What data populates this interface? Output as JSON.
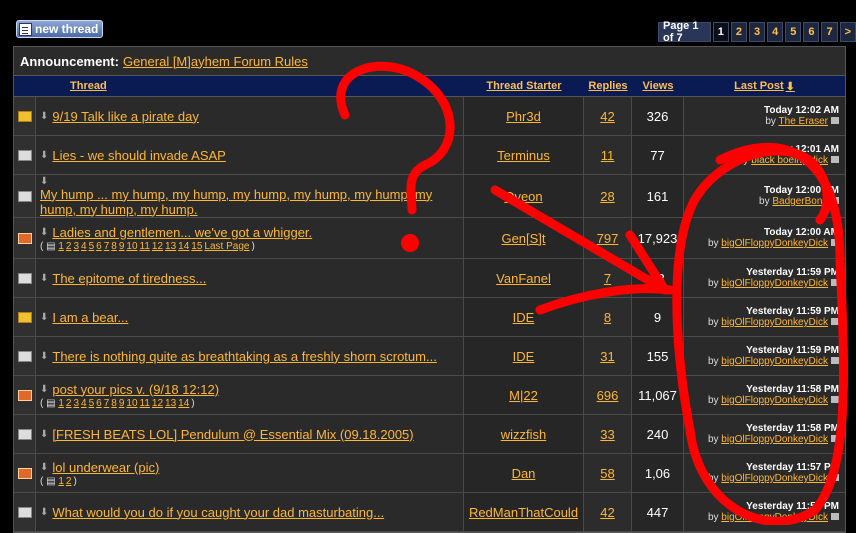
{
  "toolbar": {
    "new_thread_label": "new thread"
  },
  "pager": {
    "label": "Page 1 of 7",
    "current": "1",
    "pages": [
      "2",
      "3",
      "4",
      "5",
      "6",
      "7"
    ],
    "next": ">"
  },
  "announcement": {
    "prefix": "Announcement:",
    "title": "General [M]ayhem Forum Rules"
  },
  "columns": {
    "thread": "Thread",
    "starter": "Thread Starter",
    "replies": "Replies",
    "views": "Views",
    "last_post": "Last Post"
  },
  "threads": [
    {
      "icon": "poll",
      "title": "9/19 Talk like a pirate day",
      "starter": "Phr3d",
      "replies": "42",
      "views": "326",
      "lp_date": "Today 12:02 AM",
      "lp_user": "The Eraser",
      "h": 38
    },
    {
      "icon": "normal",
      "title": "Lies - we should invade ASAP",
      "starter": "Terminus",
      "replies": "11",
      "views": "77",
      "lp_date": "Today 12:01 AM",
      "lp_user": "black boeing dick",
      "h": 38
    },
    {
      "icon": "normal",
      "title": "My hump ... my hump, my hump, my hump, my hump, my hump, my hump, my hump, my hump.",
      "starter": "Qveon",
      "replies": "28",
      "views": "161",
      "lp_date": "Today 12:00 AM",
      "lp_user": "BadgerBong",
      "h": 42
    },
    {
      "icon": "hot",
      "title": "Ladies and gentlemen... we've got a whigger.",
      "pages": [
        "1",
        "2",
        "3",
        "4",
        "5",
        "6",
        "7",
        "8",
        "9",
        "10",
        "11",
        "12",
        "13",
        "14",
        "15"
      ],
      "last_page": "Last Page",
      "starter": "Gen[S]t",
      "replies": "797",
      "views": "17,923",
      "lp_date": "Today 12:00 AM",
      "lp_user": "bigOlFloppyDonkeyDick",
      "h": 40
    },
    {
      "icon": "normal",
      "title": "The epitome of tiredness...",
      "starter": "VanFanel",
      "replies": "7",
      "views": "33",
      "lp_date": "Yesterday 11:59 PM",
      "lp_user": "bigOlFloppyDonkeyDick",
      "h": 38
    },
    {
      "icon": "poll",
      "title": "I am a bear...",
      "starter": "IDE",
      "replies": "8",
      "views": "9",
      "lp_date": "Yesterday 11:59 PM",
      "lp_user": "bigOlFloppyDonkeyDick",
      "h": 38
    },
    {
      "icon": "normal",
      "title": "There is nothing quite as breathtaking as a freshly shorn scrotum...",
      "starter": "IDE",
      "replies": "31",
      "views": "155",
      "lp_date": "Yesterday 11:59 PM",
      "lp_user": "bigOlFloppyDonkeyDick",
      "h": 38
    },
    {
      "icon": "hot",
      "title": "post your pics v. (9/18 12:12)",
      "pages": [
        "1",
        "2",
        "3",
        "4",
        "5",
        "6",
        "7",
        "8",
        "9",
        "10",
        "11",
        "12",
        "13",
        "14"
      ],
      "starter": "M|22",
      "replies": "696",
      "views": "11,067",
      "lp_date": "Yesterday 11:58 PM",
      "lp_user": "bigOlFloppyDonkeyDick",
      "h": 38
    },
    {
      "icon": "normal",
      "title": "[FRESH BEATS LOL] Pendulum @ Essential Mix (09.18.2005)",
      "starter": "wizzfish",
      "replies": "33",
      "views": "240",
      "lp_date": "Yesterday 11:58 PM",
      "lp_user": "bigOlFloppyDonkeyDick",
      "h": 38
    },
    {
      "icon": "hot",
      "title": "lol underwear (pic)",
      "pages": [
        "1",
        "2"
      ],
      "starter": "Dan",
      "replies": "58",
      "views": "1,06",
      "lp_date": "Yesterday 11:57 PM",
      "lp_user": "bigOlFloppyDonkeyDick",
      "h": 38
    },
    {
      "icon": "normal",
      "title": "What would you do if you caught your dad masturbating...",
      "starter": "RedManThatCould",
      "replies": "42",
      "views": "447",
      "lp_date": "Yesterday 11:55 PM",
      "lp_user": "bigOlFloppyDonkeyDick",
      "h": 38
    }
  ],
  "labels": {
    "by": "by"
  }
}
